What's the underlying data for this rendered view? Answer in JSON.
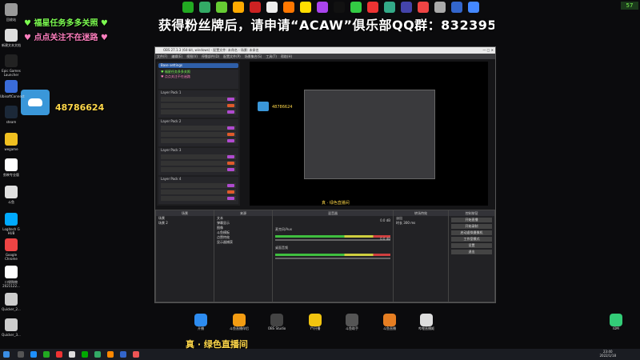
{
  "colors": {
    "accent_green": "#7cfc50",
    "pink": "#ff7fbf",
    "discord": "#3a97d9",
    "obs_bg": "#2b2b2e",
    "mixer_green": "#3fbf3f"
  },
  "banner": "获得粉丝牌后，请申请“ACAW”俱乐部QQ群：832395271",
  "overlay": {
    "line1": "福星任务多多关照",
    "line2": "点点关注不在迷路",
    "discord_number": "48786624"
  },
  "fps": "57",
  "desktop_icons": [
    {
      "label": "回收站",
      "icon": "recycle-bin-icon"
    },
    {
      "label": "新建文本文档",
      "icon": "text-doc-icon"
    },
    {
      "label": "Epic Games Launcher",
      "icon": "epic-icon"
    },
    {
      "label": "UbisoftConnect",
      "icon": "ubisoft-icon"
    },
    {
      "label": "steam",
      "icon": "steam-icon"
    },
    {
      "label": "wegame",
      "icon": "wegame-icon"
    },
    {
      "label": "剪映专业版",
      "icon": "capcut-icon"
    },
    {
      "label": "斗鱼",
      "icon": "douyu-icon"
    },
    {
      "label": "Logitech G HUB",
      "icon": "ghub-icon"
    },
    {
      "label": "Google Chrome",
      "icon": "chrome-icon"
    },
    {
      "label": "口袋购物2021122...",
      "icon": "qr-icon"
    },
    {
      "label": "Quicker_2...",
      "icon": "quicker-icon"
    },
    {
      "label": "Quicker_3...",
      "icon": "quicker-icon"
    }
  ],
  "bottom_icons": [
    {
      "label": "开播",
      "color": "#2d8cf0"
    },
    {
      "label": "斗鱼直播伴侣",
      "color": "#f39c12"
    },
    {
      "label": "OBS Studio",
      "color": "#444"
    },
    {
      "label": "YY开播",
      "color": "#f1c40f"
    },
    {
      "label": "斗鱼助手",
      "color": "#555"
    },
    {
      "label": "斗鱼直播",
      "color": "#e67e22"
    },
    {
      "label": "哔哩直播姬",
      "color": "#ddd"
    },
    {
      "label": "IDM",
      "color": "#3c7"
    }
  ],
  "bottom_caption": "真 · 绿色直播间",
  "obs": {
    "title": "OBS 27.1.3 (64-bit, windows) - 配置文件: 未命名 - 场景: 未命名",
    "menu": [
      "文件(F)",
      "编辑(E)",
      "视图(V)",
      "停靠部件(D)",
      "配置文件(P)",
      "场景集合(S)",
      "工具(T)",
      "帮助(H)"
    ],
    "layer_title": "Base settings",
    "layers": [
      "Layer Pack 1",
      "Layer Pack 2",
      "Layer Pack 3",
      "Layer Pack 4"
    ],
    "scenes_header": "场景",
    "scenes": [
      "场景",
      "场景 2"
    ],
    "sources_header": "来源",
    "sources": [
      "文本",
      "弹幕显示",
      "图像",
      "斗鱼模板",
      "点赞特效",
      "显示器捕获"
    ],
    "mixer_header": "混音器",
    "mixer": [
      {
        "name": "麦克风/Aux",
        "db": "0.0 dB"
      },
      {
        "name": "桌面音频",
        "db": "0.0 dB"
      }
    ],
    "transition_header": "转场特效",
    "transition": {
      "label1": "淡出",
      "label2": "时长",
      "value": "300 ms"
    },
    "controls_header": "控制按钮",
    "controls": [
      "开始直播",
      "开始录制",
      "启动虚拟摄像机",
      "工作室模式",
      "设置",
      "退出"
    ],
    "preview_caption": "真 · 绿色直播间"
  },
  "clock": {
    "time": "23:40",
    "date": "2022/1/18"
  }
}
